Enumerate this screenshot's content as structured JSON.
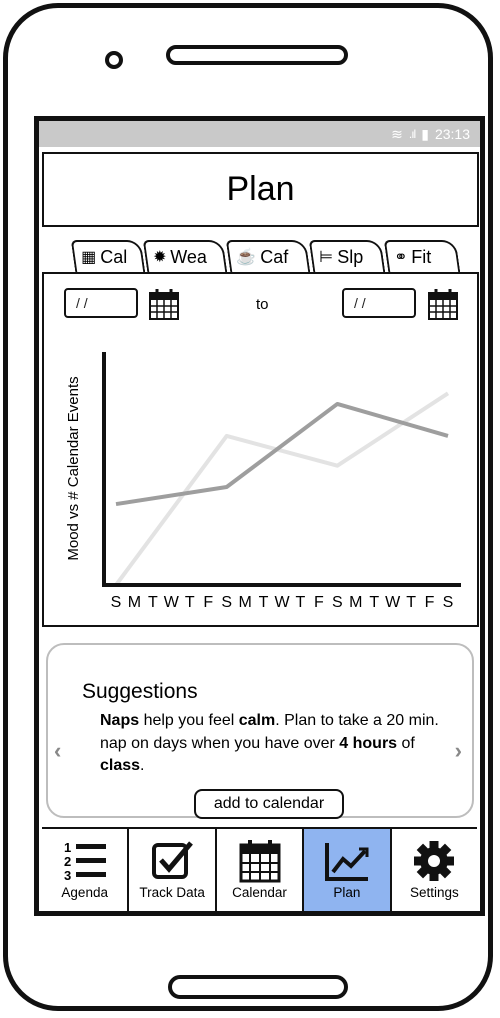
{
  "status": {
    "time": "23:13"
  },
  "title": "Plan",
  "tabs": [
    {
      "label": "Cal",
      "icon": "calendar-icon"
    },
    {
      "label": "Wea",
      "icon": "sun-icon"
    },
    {
      "label": "Caf",
      "icon": "coffee-icon"
    },
    {
      "label": "Slp",
      "icon": "bed-icon"
    },
    {
      "label": "Fit",
      "icon": "bicycle-icon"
    }
  ],
  "date_range": {
    "from": "/ /",
    "to_label": "to",
    "to": "/ /"
  },
  "chart_data": {
    "type": "line",
    "ylabel": "Mood vs # Calendar Events",
    "x": [
      "S",
      "M",
      "T",
      "W",
      "T",
      "F",
      "S",
      "M",
      "T",
      "W",
      "T",
      "F",
      "S",
      "M",
      "T",
      "W",
      "T",
      "F",
      "S"
    ],
    "series": [
      {
        "color": "#9e9e9e",
        "points": [
          [
            0,
            0.38
          ],
          [
            6,
            0.46
          ],
          [
            12,
            0.85
          ],
          [
            18,
            0.7
          ]
        ]
      },
      {
        "color": "#e3e3e3",
        "points": [
          [
            0,
            0.0
          ],
          [
            6,
            0.7
          ],
          [
            12,
            0.56
          ],
          [
            18,
            0.9
          ]
        ]
      }
    ],
    "ylim": [
      0,
      1
    ]
  },
  "suggestions": {
    "title": "Suggestions",
    "s1": "Naps",
    "s2": " help you feel ",
    "s3": "calm",
    "s4": ". Plan to take a 20 min. nap on days when you have over ",
    "s5": "4 hours",
    "s6": " of ",
    "s7": "class",
    "s8": ".",
    "button": "add to calendar",
    "prev": "‹",
    "next": "›"
  },
  "nav": [
    {
      "label": "Agenda",
      "icon": "list-icon"
    },
    {
      "label": "Track Data",
      "icon": "checkbox-icon"
    },
    {
      "label": "Calendar",
      "icon": "calendar-icon"
    },
    {
      "label": "Plan",
      "icon": "chart-icon",
      "active": true
    },
    {
      "label": "Settings",
      "icon": "gear-icon"
    }
  ],
  "colors": {
    "statusbar": "#c9c9c9",
    "active_nav": "#8fb4f0"
  }
}
